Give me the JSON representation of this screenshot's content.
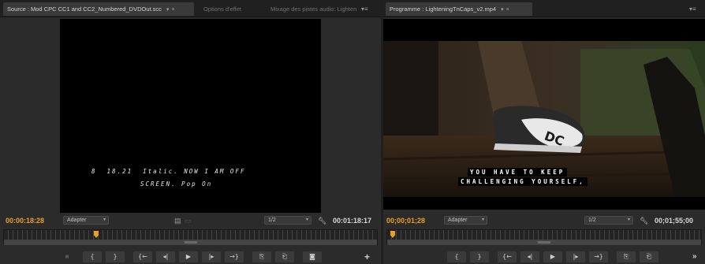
{
  "source_panel": {
    "tabs": [
      {
        "label": "Source : Mod CPC CC1 and CC2_Numbered_DVDOut.scc",
        "menu": "▾",
        "close": "×",
        "active": true
      },
      {
        "label": "Options d'effet",
        "active": false
      },
      {
        "label": "Mixage des pistes audio: Lighten",
        "active": false
      }
    ],
    "panel_menu": "▾≡",
    "caption_lines": [
      "8  18.21  Italic. NOW I AM OFF",
      "SCREEN. Pop On"
    ],
    "timecode_current": "00:00:18:28",
    "fit_select": "Adapter",
    "resolution_select": "1/2",
    "timecode_duration": "00:01:18:17",
    "transport_buttons": [
      "{",
      "}",
      "{←",
      "◂|",
      "▶",
      "|▸",
      "→}",
      "⎘",
      "⎗",
      "◙"
    ],
    "add_button": "+"
  },
  "program_panel": {
    "tab_label": "Programme : LighteningTnCaps_v2.mp4",
    "tab_menu": "▾",
    "tab_close": "×",
    "panel_menu": "▾≡",
    "subtitle_lines": [
      "YOU HAVE TO KEEP",
      "CHALLENGING YOURSELF,"
    ],
    "timecode_current": "00;00;01;28",
    "fit_select": "Adapter",
    "resolution_select": "1/2",
    "timecode_duration": "00;01;55;00",
    "transport_buttons": [
      "{",
      "}",
      "{←",
      "◂|",
      "▶",
      "|▸",
      "→}",
      "⎘",
      "⎗"
    ],
    "overflow": "»"
  },
  "colors": {
    "timecode_orange": "#e8a125",
    "panel_bg": "#2b2b2b",
    "viewer_bg": "#000000"
  }
}
